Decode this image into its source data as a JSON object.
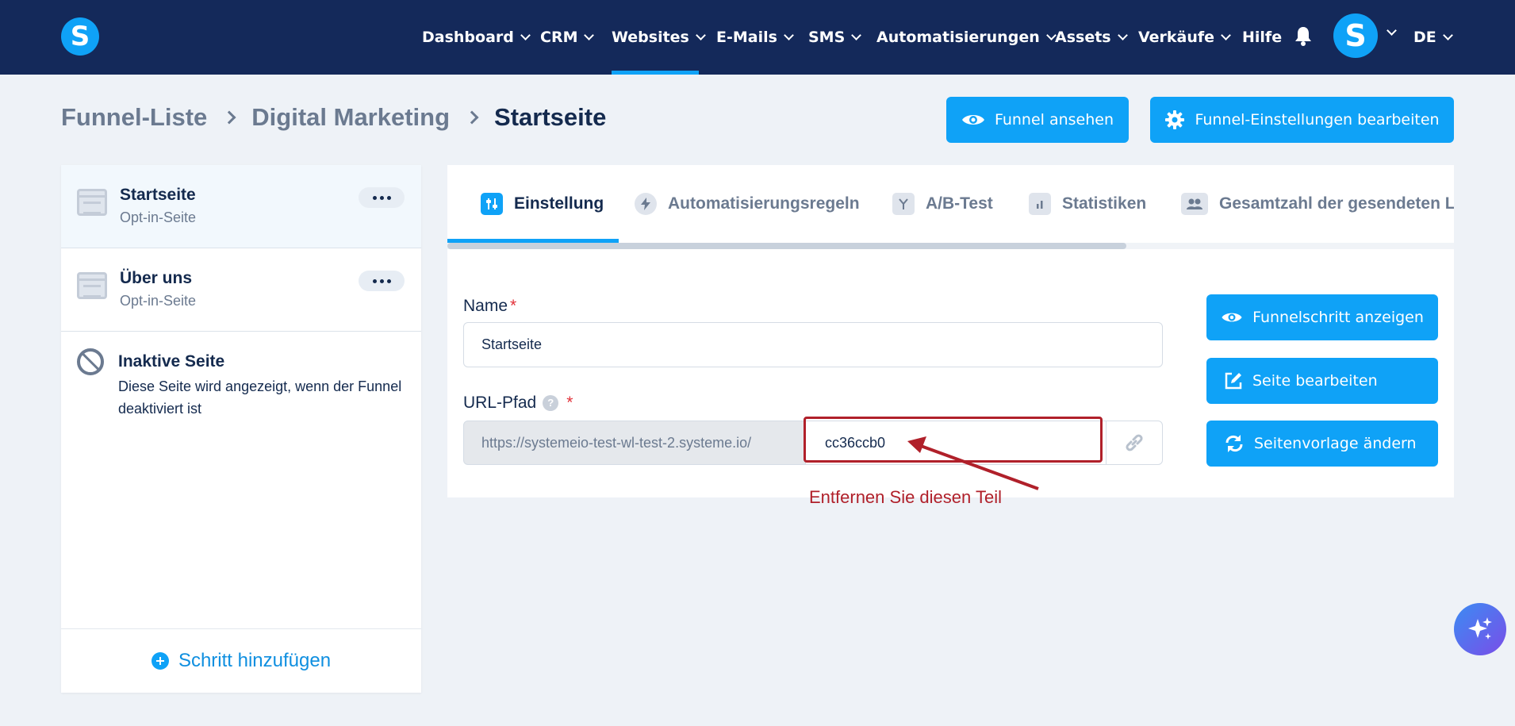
{
  "nav": {
    "items": [
      {
        "label": "Dashboard",
        "dropdown": true
      },
      {
        "label": "CRM",
        "dropdown": true
      },
      {
        "label": "Websites",
        "dropdown": true,
        "active": true
      },
      {
        "label": "E-Mails",
        "dropdown": true
      },
      {
        "label": "SMS",
        "dropdown": true
      },
      {
        "label": "Automatisierungen",
        "dropdown": true
      },
      {
        "label": "Assets",
        "dropdown": true
      },
      {
        "label": "Verkäufe",
        "dropdown": true
      },
      {
        "label": "Hilfe",
        "dropdown": false
      }
    ],
    "logo_letter": "S",
    "avatar_letter": "S",
    "language": "DE",
    "accent_color": "#0fa2f7",
    "background_color": "#14295a"
  },
  "breadcrumb": {
    "items": [
      "Funnel-Liste",
      "Digital Marketing"
    ],
    "current": "Startseite"
  },
  "header_actions": {
    "view_funnel": "Funnel ansehen",
    "edit_funnel_settings": "Funnel-Einstellungen bearbeiten"
  },
  "sidebar": {
    "steps": [
      {
        "title": "Startseite",
        "subtitle": "Opt-in-Seite",
        "active": true
      },
      {
        "title": "Über uns",
        "subtitle": "Opt-in-Seite",
        "active": false
      }
    ],
    "inactive": {
      "title": "Inaktive Seite",
      "description": "Diese Seite wird angezeigt, wenn der Funnel deaktiviert ist"
    },
    "add_step": "Schritt hinzufügen"
  },
  "tabs": [
    {
      "label": "Einstellung",
      "icon": "sliders-icon",
      "active": true
    },
    {
      "label": "Automatisierungsregeln",
      "icon": "bolt-icon",
      "active": false
    },
    {
      "label": "A/B-Test",
      "icon": "split-icon",
      "active": false
    },
    {
      "label": "Statistiken",
      "icon": "bar-chart-icon",
      "active": false
    },
    {
      "label": "Gesamtzahl der gesendeten L",
      "icon": "users-icon",
      "active": false
    }
  ],
  "form": {
    "name_label": "Name",
    "name_value": "Startseite",
    "url_label": "URL-Pfad",
    "help_glyph": "?",
    "required_mark": "*",
    "url_prefix": "https://systemeio-test-wl-test-2.systeme.io/",
    "url_value": "cc36ccb0"
  },
  "side_actions": {
    "show_step": "Funnelschritt anzeigen",
    "edit_page": "Seite bearbeiten",
    "change_template": "Seitenvorlage ändern"
  },
  "annotation": {
    "text": "Entfernen Sie diesen Teil",
    "color": "#b0202a"
  }
}
